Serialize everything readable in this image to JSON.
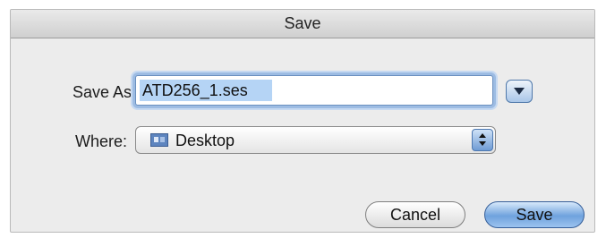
{
  "window": {
    "title": "Save"
  },
  "form": {
    "save_as_label": "Save As:",
    "filename": "ATD256_1.ses",
    "where_label": "Where:",
    "where_value": "Desktop",
    "where_icon": "desktop-folder-icon",
    "expand_icon": "disclosure-triangle-icon",
    "popup_icon": "up-down-arrows-icon"
  },
  "buttons": {
    "cancel_label": "Cancel",
    "save_label": "Save"
  },
  "colors": {
    "default_button": "#6fa2dd",
    "focus_ring": "#9dbce3",
    "text_selection": "#b5d4f5"
  }
}
